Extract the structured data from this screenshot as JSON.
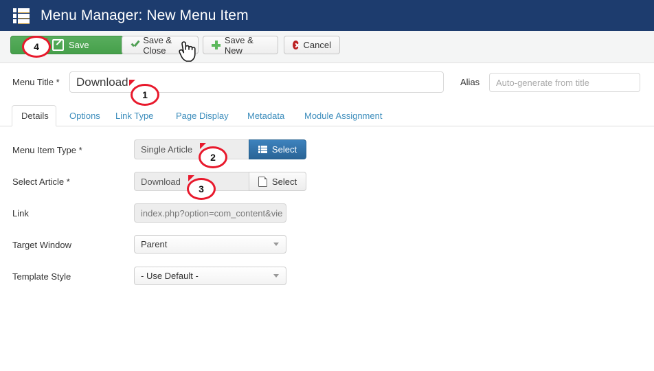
{
  "header": {
    "title": "Menu Manager: New Menu Item",
    "icon": "menu-list-icon",
    "bg_color": "#1d3c6e"
  },
  "toolbar": {
    "save_label": "Save",
    "save_close_label": "Save & Close",
    "save_new_label": "Save & New",
    "cancel_label": "Cancel",
    "save_color": "#4ba250",
    "bg_color": "#f4f5f5"
  },
  "form": {
    "menu_title_label": "Menu Title *",
    "menu_title_value": "Download",
    "alias_label": "Alias",
    "alias_placeholder": "Auto-generate from title",
    "menu_item_type_label": "Menu Item Type *",
    "menu_item_type_value": "Single Article",
    "menu_item_type_select_label": "Select",
    "select_article_label": "Select Article *",
    "select_article_value": "Download",
    "select_article_select_label": "Select",
    "link_label": "Link",
    "link_value": "index.php?option=com_content&vie",
    "target_window_label": "Target Window",
    "target_window_value": "Parent",
    "template_style_label": "Template Style",
    "template_style_value": "- Use Default -"
  },
  "tabs": [
    {
      "label": "Details",
      "active": true
    },
    {
      "label": "Options",
      "active": false
    },
    {
      "label": "Link Type",
      "active": false
    },
    {
      "label": "Page Display",
      "active": false
    },
    {
      "label": "Metadata",
      "active": false
    },
    {
      "label": "Module Assignment",
      "active": false
    }
  ],
  "annotations": [
    {
      "number": "1"
    },
    {
      "number": "2"
    },
    {
      "number": "3"
    },
    {
      "number": "4"
    }
  ],
  "accent_colors": {
    "annotation_red": "#e8192c",
    "link_blue": "#3c8dbc",
    "button_blue": "#2a6496"
  }
}
